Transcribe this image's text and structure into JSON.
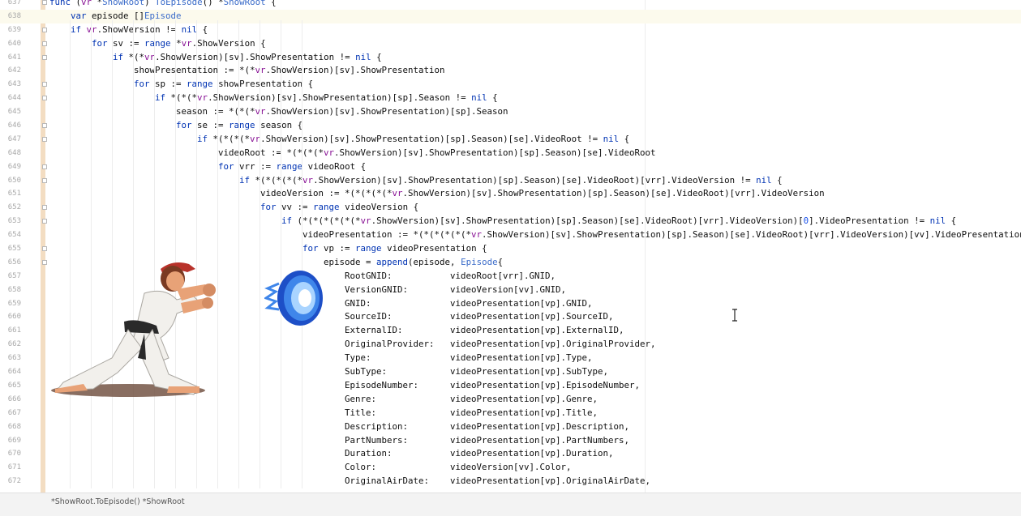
{
  "editor": {
    "lines": [
      {
        "n": "637",
        "code": "func (vr *ShowRoot) ToEpisode() *ShowRoot {"
      },
      {
        "n": "638",
        "code": "    var episode []Episode"
      },
      {
        "n": "639",
        "code": "    if vr.ShowVersion != nil {"
      },
      {
        "n": "640",
        "code": "        for sv := range *vr.ShowVersion {"
      },
      {
        "n": "641",
        "code": "            if *(*vr.ShowVersion)[sv].ShowPresentation != nil {"
      },
      {
        "n": "642",
        "code": "                showPresentation := *(*vr.ShowVersion)[sv].ShowPresentation"
      },
      {
        "n": "643",
        "code": "                for sp := range showPresentation {"
      },
      {
        "n": "644",
        "code": "                    if *(*(*vr.ShowVersion)[sv].ShowPresentation)[sp].Season != nil {"
      },
      {
        "n": "645",
        "code": "                        season := *(*(*vr.ShowVersion)[sv].ShowPresentation)[sp].Season"
      },
      {
        "n": "646",
        "code": "                        for se := range season {"
      },
      {
        "n": "647",
        "code": "                            if *(*(*(*vr.ShowVersion)[sv].ShowPresentation)[sp].Season)[se].VideoRoot != nil {"
      },
      {
        "n": "648",
        "code": "                                videoRoot := *(*(*(*vr.ShowVersion)[sv].ShowPresentation)[sp].Season)[se].VideoRoot"
      },
      {
        "n": "649",
        "code": "                                for vrr := range videoRoot {"
      },
      {
        "n": "650",
        "code": "                                    if *(*(*(*(*vr.ShowVersion)[sv].ShowPresentation)[sp].Season)[se].VideoRoot)[vrr].VideoVersion != nil {"
      },
      {
        "n": "651",
        "code": "                                        videoVersion := *(*(*(*(*vr.ShowVersion)[sv].ShowPresentation)[sp].Season)[se].VideoRoot)[vrr].VideoVersion"
      },
      {
        "n": "652",
        "code": "                                        for vv := range videoVersion {"
      },
      {
        "n": "653",
        "code": "                                            if (*(*(*(*(*(*vr.ShowVersion)[sv].ShowPresentation)[sp].Season)[se].VideoRoot)[vrr].VideoVersion)[0].VideoPresentation != nil {"
      },
      {
        "n": "654",
        "code": "                                                videoPresentation := *(*(*(*(*(*vr.ShowVersion)[sv].ShowPresentation)[sp].Season)[se].VideoRoot)[vrr].VideoVersion)[vv].VideoPresentation"
      },
      {
        "n": "655",
        "code": "                                                for vp := range videoPresentation {"
      },
      {
        "n": "656",
        "code": "                                                    episode = append(episode, Episode{"
      },
      {
        "n": "657",
        "code": "                                                        RootGNID:           videoRoot[vrr].GNID,"
      },
      {
        "n": "658",
        "code": "                                                        VersionGNID:        videoVersion[vv].GNID,"
      },
      {
        "n": "659",
        "code": "                                                        GNID:               videoPresentation[vp].GNID,"
      },
      {
        "n": "660",
        "code": "                                                        SourceID:           videoPresentation[vp].SourceID,"
      },
      {
        "n": "661",
        "code": "                                                        ExternalID:         videoPresentation[vp].ExternalID,"
      },
      {
        "n": "662",
        "code": "                                                        OriginalProvider:   videoPresentation[vp].OriginalProvider,"
      },
      {
        "n": "663",
        "code": "                                                        Type:               videoPresentation[vp].Type,"
      },
      {
        "n": "664",
        "code": "                                                        SubType:            videoPresentation[vp].SubType,"
      },
      {
        "n": "665",
        "code": "                                                        EpisodeNumber:      videoPresentation[vp].EpisodeNumber,"
      },
      {
        "n": "666",
        "code": "                                                        Genre:              videoPresentation[vp].Genre,"
      },
      {
        "n": "667",
        "code": "                                                        Title:              videoPresentation[vp].Title,"
      },
      {
        "n": "668",
        "code": "                                                        Description:        videoPresentation[vp].Description,"
      },
      {
        "n": "669",
        "code": "                                                        PartNumbers:        videoPresentation[vp].PartNumbers,"
      },
      {
        "n": "670",
        "code": "                                                        Duration:           videoPresentation[vp].Duration,"
      },
      {
        "n": "671",
        "code": "                                                        Color:              videoVersion[vv].Color,"
      },
      {
        "n": "672",
        "code": "                                                        OriginalAirDate:    videoPresentation[vp].OriginalAirDate,"
      }
    ],
    "current_line": "638"
  },
  "status_bar": {
    "breadcrumb": "*ShowRoot.ToEpisode() *ShowRoot"
  },
  "colors": {
    "keyword": "#0033b3",
    "receiver": "#871094",
    "type": "#3a6bc9",
    "number": "#1750eb",
    "gutter_fold_column": "#f3ddc2",
    "current_line_bg": "#fcfaed"
  },
  "icons": {
    "cursor": "text-cursor-icon",
    "fighter": "fighter-sprite",
    "fireball": "fireball-sprite"
  }
}
